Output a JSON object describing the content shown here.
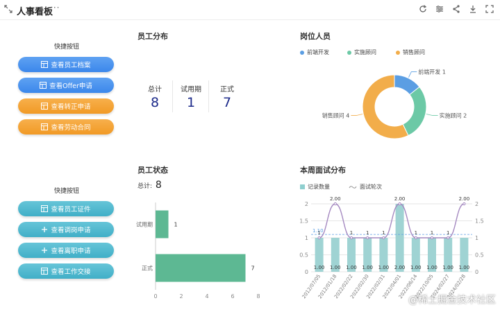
{
  "header": {
    "title": "人事看板",
    "more": "···"
  },
  "quick1": {
    "title": "快捷按钮",
    "buttons": [
      "查看员工档案",
      "查看Offer申请",
      "查看转正申请",
      "查看劳动合同"
    ]
  },
  "quick2": {
    "title": "快捷按钮",
    "buttons": [
      "查看员工证件",
      "查看调岗申请",
      "查看离职申请",
      "查看工作交接"
    ]
  },
  "distribution": {
    "title": "员工分布",
    "stats": [
      {
        "label": "总计",
        "value": "8"
      },
      {
        "label": "试用期",
        "value": "1"
      },
      {
        "label": "正式",
        "value": "7"
      }
    ]
  },
  "positions": {
    "title": "岗位人员",
    "legend": [
      "前端开发",
      "实施顾问",
      "销售顾问"
    ],
    "colors": [
      "#5b9ee3",
      "#6cc9a6",
      "#f2ad4a"
    ],
    "labels": [
      "前端开发  1",
      "实施顾问  2",
      "销售顾问  4"
    ]
  },
  "status": {
    "title": "员工状态",
    "total_label": "总计:",
    "total_value": "8"
  },
  "interviews": {
    "title": "本周面试分布",
    "legend_bar": "记录数量",
    "legend_line": "面试轮次"
  },
  "watermark": "@稀土掘金技术社区",
  "chart_data": [
    {
      "type": "pie",
      "categories": [
        "前端开发",
        "实施顾问",
        "销售顾问"
      ],
      "values": [
        1,
        2,
        4
      ],
      "legend": [
        "前端开发",
        "实施顾问",
        "销售顾问"
      ]
    },
    {
      "type": "bar",
      "orientation": "horizontal",
      "categories": [
        "试用期",
        "正式"
      ],
      "values": [
        1,
        7
      ],
      "xlim": [
        0,
        8
      ],
      "xticks": [
        0,
        2,
        4,
        6,
        8
      ]
    },
    {
      "type": "bar",
      "categories": [
        "2012/07/05",
        "2012/01/18",
        "2022/02/22",
        "2022/02/30",
        "2022/02/31",
        "2022/04/01",
        "2022/06/14",
        "2022/10/05",
        "2024/02/27",
        "2024/02/28"
      ],
      "series": [
        {
          "name": "记录数量",
          "type": "bar",
          "values": [
            1,
            1,
            1,
            1,
            1,
            2,
            1,
            1,
            1,
            1
          ],
          "labels": [
            "1.00",
            "1.00",
            "1.00",
            "1.00",
            "1.00",
            "2.00",
            "1.00",
            "1.00",
            "1.00",
            "1.00"
          ]
        },
        {
          "name": "面试轮次",
          "type": "line",
          "values": [
            1,
            2,
            1,
            1,
            1,
            2,
            1,
            1,
            1,
            2
          ],
          "labels": [
            "1",
            "2.00",
            "1",
            "1",
            "1",
            "2.00",
            "1",
            "1",
            "1",
            "2.00"
          ]
        }
      ],
      "markline": {
        "label": "1.10",
        "value": 1.1
      },
      "ylim": [
        0,
        2
      ],
      "yticks": [
        "0",
        "0.5",
        "1",
        "1.5",
        "2"
      ],
      "y2ticks": [
        "0",
        "0.5",
        "1",
        "1.5",
        "2"
      ],
      "legend": [
        "记录数量",
        "面试轮次"
      ]
    }
  ]
}
